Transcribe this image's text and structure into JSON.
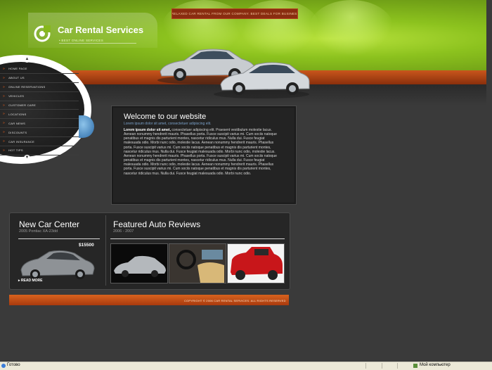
{
  "header": {
    "top_bar_text": "ENJOY RELAXED CAR RENTAL FROM OUR COMPANY. BEST DEALS FOR BUSINESS TRIPS",
    "logo_title": "Car Rental Services",
    "logo_subtitle": "• BEST ONLINE SERVICES"
  },
  "menu": {
    "items": [
      {
        "label": "HOME PAGE"
      },
      {
        "label": "ABOUT US"
      },
      {
        "label": "ONLINE RESERVATIONS"
      },
      {
        "label": "VEHICLES"
      },
      {
        "label": "CUSTOMER CARE"
      },
      {
        "label": "LOCATIONS"
      },
      {
        "label": "CAR NEWS"
      },
      {
        "label": "DISCOUNTS"
      },
      {
        "label": "CAR INSURANCE"
      },
      {
        "label": "HOT TIPS"
      }
    ]
  },
  "welcome": {
    "title": "Welcome to our website",
    "subtitle": "Lorem ipsum dolor sit amet, consectetuer adipiscing elit.",
    "lead": "Lorem ipsum dolor sit amet,",
    "body": "consectetuer adipiscing elit. Praesent vestibulum molestie lacus. Aenean nonummy hendrerit mauris. Phasellus porta. Fusce suscipit varius mi. Cum sociis natoque penatibus et magnis dis parturient montes, nascetur ridiculus mus. Nulla dui. Fusce feugiat malesuada odio. Morbi nunc odio, molestie lacus. Aenean nonummy hendrerit mauris. Phasellus porta. Fusce suscipit varius mi. Cum sociis natoque penatibus et magnis dis parturient montes, nascetur ridiculus mus. Nulla dui. Fusce feugiat malesuada odio. Morbi nunc odio, molestie lacus. Aenean nonummy hendrerit mauris. Phasellus porta. Fusce suscipit varius mi. Cum sociis natoque penatibus et magnis dis parturient montes, nascetur ridiculus mus. Nulla dui. Fusce feugiat malesuada odio. Morbi nunc odio, molestie lacus. Aenean nonummy hendrerit mauris. Phasellus porta. Fusce suscipit varius mi. Cum sociis natoque penatibus et magnis dis parturient montes, nascetur ridiculus mus. Nulla dui. Fusce feugiat malesuada odio. Morbi nunc odio."
  },
  "new_car_center": {
    "title": "New Car Center",
    "subtitle": "2005 Pontiac XA-23dd",
    "price": "$15500",
    "read_more": "READ MORE"
  },
  "featured": {
    "title": "Featured Auto Reviews",
    "subtitle": "2006 - 2007"
  },
  "footer": {
    "copyright": "COPYRIGHT © 2006 CAR RENTAL SERVICES. ALL RIGHTS RESERVED"
  },
  "status_bar": {
    "left_text": "Готово",
    "zone_text": "Мой компьютер"
  },
  "colors": {
    "green": "#8cc21e",
    "orange": "#c9561c",
    "dark": "#3a3a3a"
  }
}
